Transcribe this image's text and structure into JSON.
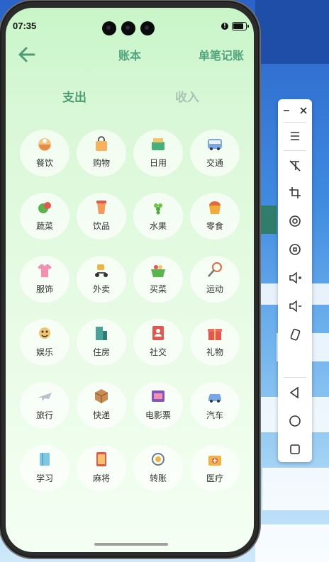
{
  "status": {
    "time": "07:35"
  },
  "header": {
    "title": "账本",
    "single_record": "单笔记账"
  },
  "tabs": [
    {
      "label": "支出",
      "active": true
    },
    {
      "label": "收入",
      "active": false
    }
  ],
  "categories": [
    {
      "label": "餐饮",
      "icon": "food-bowl-icon"
    },
    {
      "label": "购物",
      "icon": "shopping-bag-icon"
    },
    {
      "label": "日用",
      "icon": "daily-goods-icon"
    },
    {
      "label": "交通",
      "icon": "bus-icon"
    },
    {
      "label": "蔬菜",
      "icon": "vegetables-icon"
    },
    {
      "label": "饮品",
      "icon": "drink-cup-icon"
    },
    {
      "label": "水果",
      "icon": "grapes-icon"
    },
    {
      "label": "零食",
      "icon": "snack-icon"
    },
    {
      "label": "服饰",
      "icon": "tshirt-icon"
    },
    {
      "label": "外卖",
      "icon": "scooter-icon"
    },
    {
      "label": "买菜",
      "icon": "basket-icon"
    },
    {
      "label": "运动",
      "icon": "racket-icon"
    },
    {
      "label": "娱乐",
      "icon": "entertainment-icon"
    },
    {
      "label": "住房",
      "icon": "building-icon"
    },
    {
      "label": "社交",
      "icon": "contacts-icon"
    },
    {
      "label": "礼物",
      "icon": "gift-icon"
    },
    {
      "label": "旅行",
      "icon": "airplane-icon"
    },
    {
      "label": "快递",
      "icon": "package-icon"
    },
    {
      "label": "电影票",
      "icon": "movie-ticket-icon"
    },
    {
      "label": "汽车",
      "icon": "car-icon"
    },
    {
      "label": "学习",
      "icon": "book-icon"
    },
    {
      "label": "麻将",
      "icon": "mahjong-icon"
    },
    {
      "label": "转账",
      "icon": "transfer-icon"
    },
    {
      "label": "医疗",
      "icon": "medical-kit-icon"
    }
  ],
  "colors": {
    "accent": "#52a47e",
    "inactive_tab": "#aac4b4"
  },
  "toolbar": [
    "minimize-icon",
    "close-icon",
    "menu-icon",
    "touch-off-icon",
    "crop-icon",
    "rotate-icon",
    "screenshot-icon",
    "volume-up-icon",
    "volume-down-icon",
    "shake-icon",
    "nav-back-icon",
    "nav-home-icon",
    "nav-recent-icon"
  ]
}
